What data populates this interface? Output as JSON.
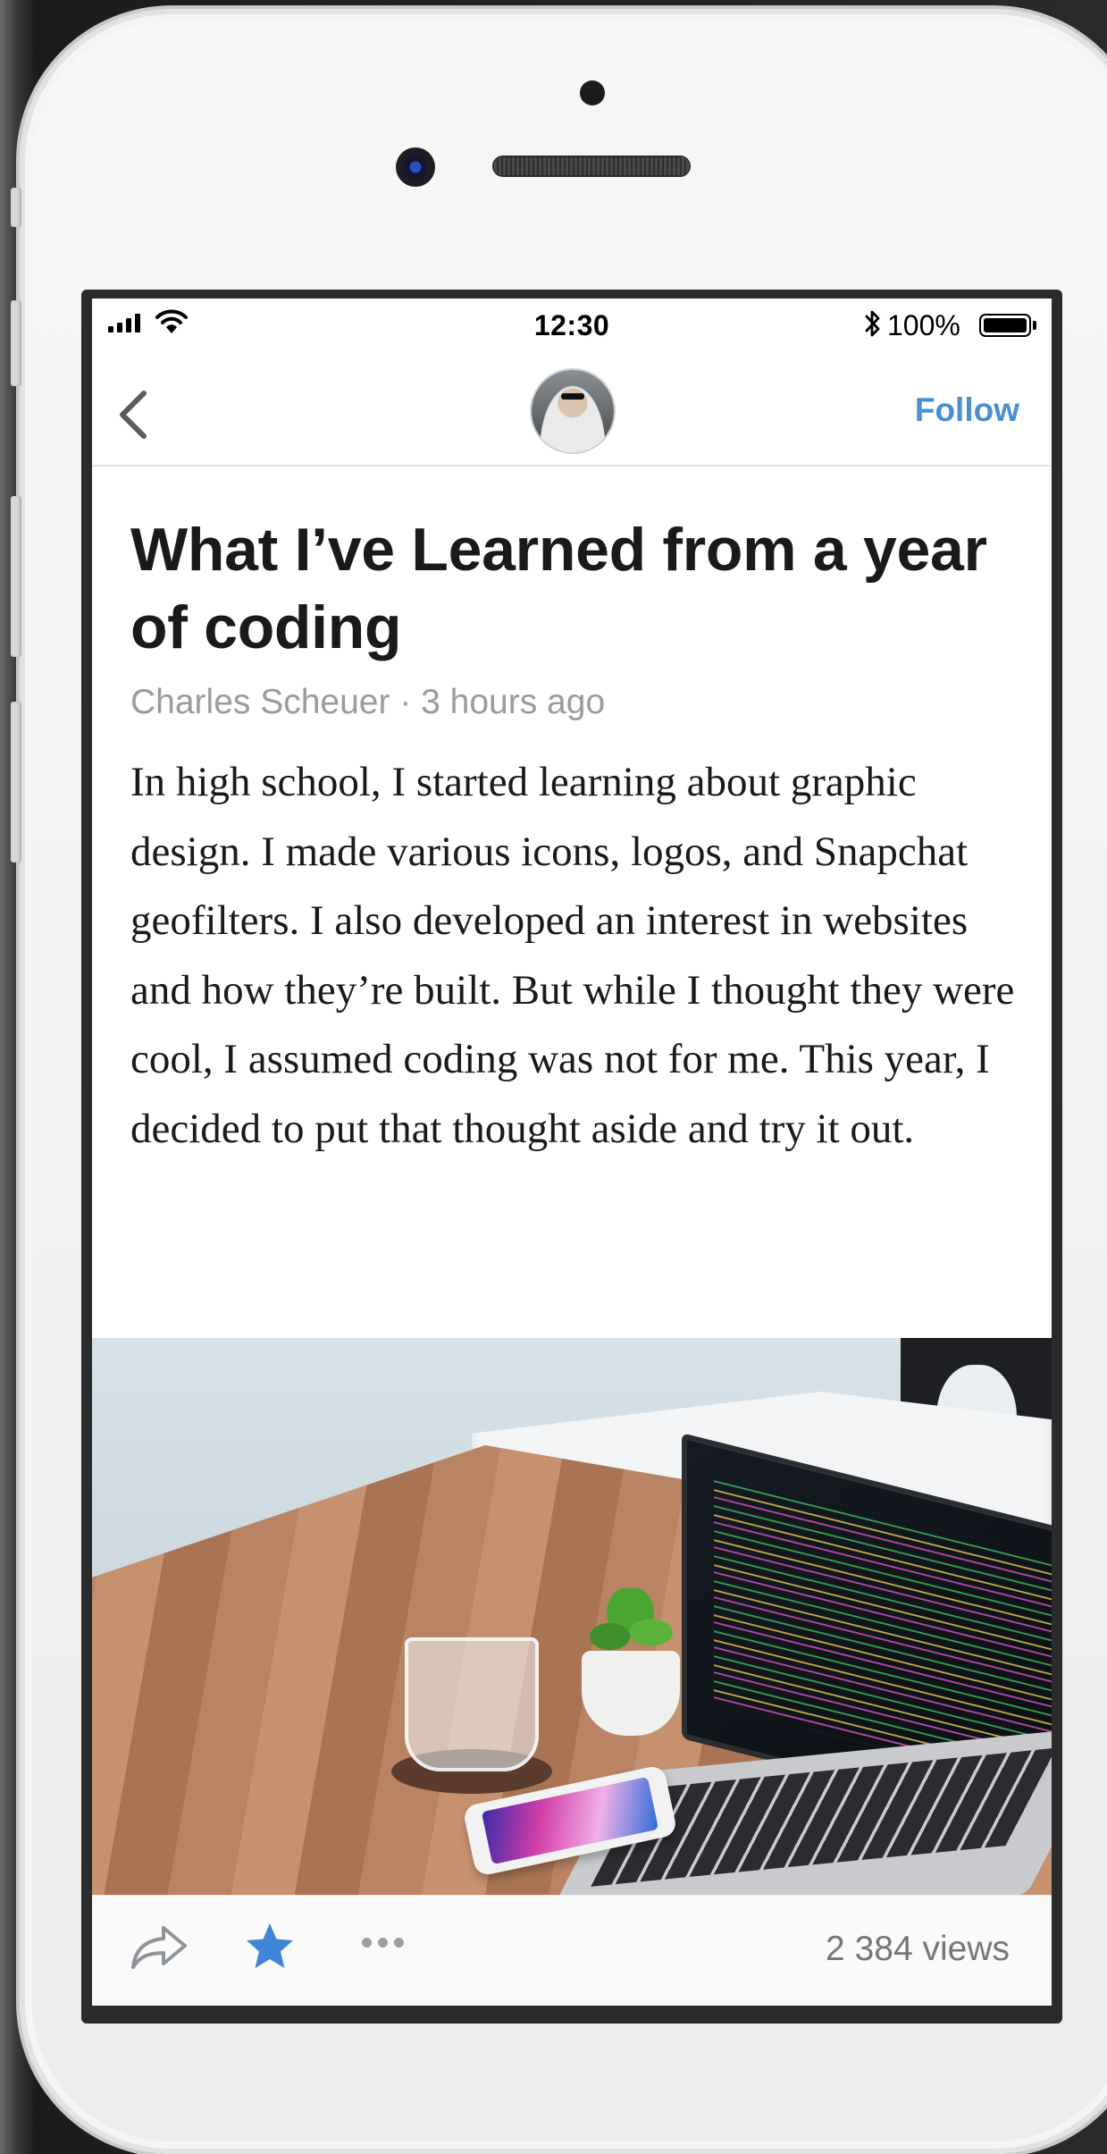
{
  "status_bar": {
    "time": "12:30",
    "battery_percent": "100%",
    "signal_icon": "cellular-signal-icon",
    "wifi_icon": "wifi-icon",
    "bluetooth_icon": "bluetooth-icon",
    "battery_icon": "battery-icon",
    "battery_level": 1.0
  },
  "nav": {
    "back_icon": "chevron-left-icon",
    "avatar": "author-avatar",
    "follow_label": "Follow"
  },
  "article": {
    "title": "What I’ve Learned from a year of coding",
    "meta": "Charles Scheuer · 3 hours ago",
    "body": "In high school, I started learning about graphic design. I made various icons, logos, and Snapchat geofilters. I also developed an interest in websites and how they’re built. But while I thought they were cool, I assumed coding was not for me. This year, I decided to put that thought aside and try it out."
  },
  "toolbar": {
    "share_icon": "share-icon",
    "star_icon": "star-icon",
    "more_icon": "more-dots-icon",
    "views": "2 384 views"
  },
  "colors": {
    "accent": "#4a90d0",
    "meta_text": "#9b9b9b",
    "title_text": "#1a1a1a"
  }
}
